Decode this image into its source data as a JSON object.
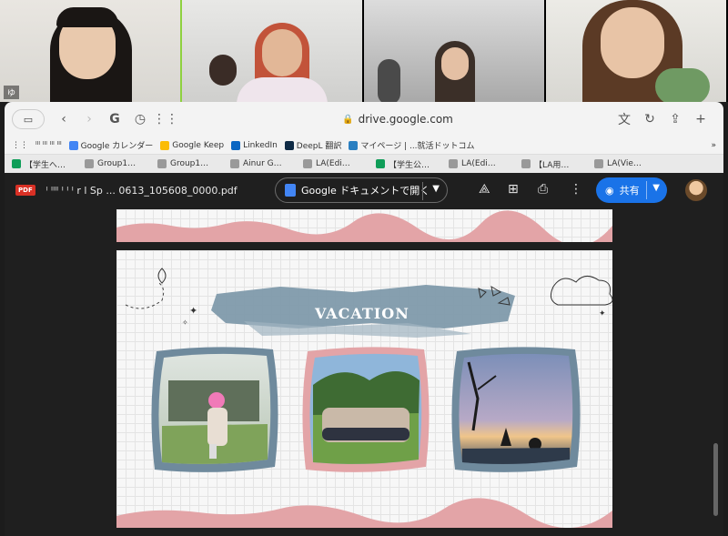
{
  "video_tiles": [
    {
      "name": "ゆ",
      "active": true
    },
    {
      "name": "",
      "active": false
    },
    {
      "name": "",
      "active": false
    },
    {
      "name": "",
      "active": false
    }
  ],
  "browser": {
    "url": "drive.google.com",
    "bookmarks": [
      "Google カレンダー",
      "Google Keep",
      "LinkedIn",
      "DeepL 翻訳",
      "マイページ | ...就活ドットコム"
    ],
    "tabs": [
      "【学生へ…",
      "Group1…",
      "Group1…",
      "Ainur G…",
      "LA(Edi…",
      "【学生公…",
      "LA(Edi…",
      "【LA用…",
      "LA(Vie…"
    ]
  },
  "viewer": {
    "file_name": "ˡ ᴵᴵᴵᴵ ᴵ ᴵ ᴵ r l Sp ... 0613_105608_0000.pdf",
    "open_label": "Google ドキュメントで開く",
    "share_label": "共有"
  },
  "slide": {
    "title": "VACATION"
  },
  "colors": {
    "accent": "#1a73e8",
    "banner": "#7f9aab",
    "pink_border": "#e3a4a7",
    "slate_border": "#6f8a9d",
    "active_speaker": "#8ed13f"
  }
}
